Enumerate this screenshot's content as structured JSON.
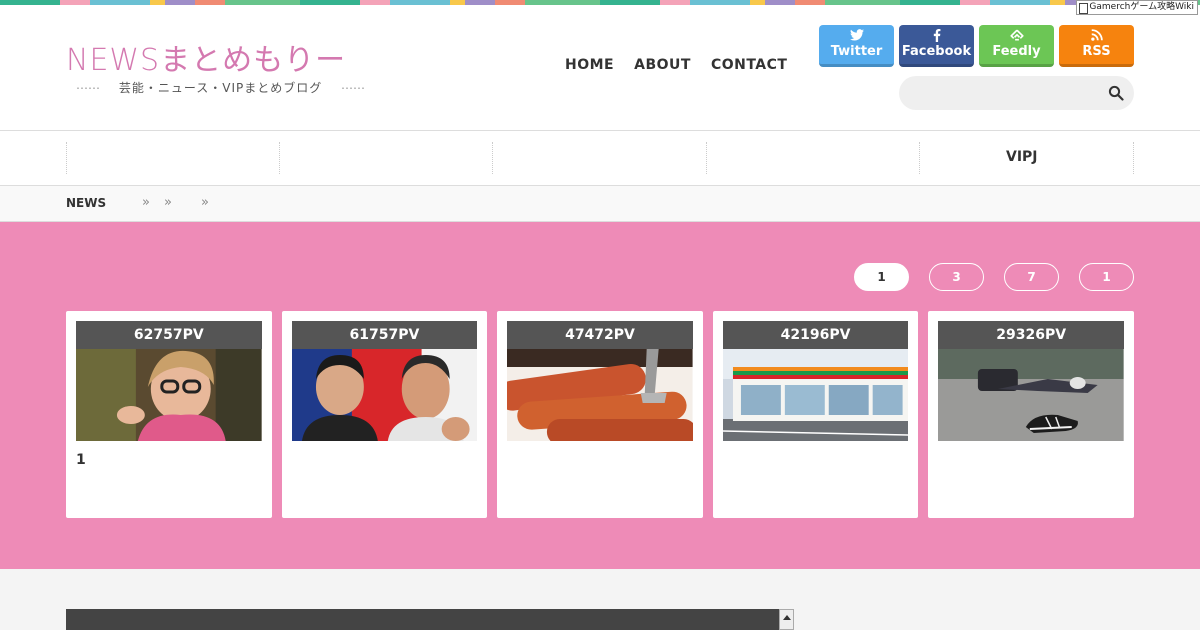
{
  "badge": {
    "text": "Gamerchゲーム攻略Wiki"
  },
  "site": {
    "logo": "NEWSまとめもりー",
    "tagline_dots_left": "⋯⋯",
    "tagline": "芸能・ニュース・VIPまとめブログ",
    "tagline_dots_right": "⋯⋯"
  },
  "nav": {
    "home": "HOME",
    "about": "ABOUT",
    "contact": "CONTACT"
  },
  "social": {
    "twitter": "Twitter",
    "facebook": "Facebook",
    "feedly": "Feedly",
    "rss": "RSS"
  },
  "search": {
    "placeholder": ""
  },
  "categories": {
    "vipj": "VIPJ"
  },
  "breadcrumb": {
    "home": "NEWS",
    "sep": "»"
  },
  "ranking": {
    "tabs": [
      "1",
      "3",
      "7",
      "1"
    ],
    "cards": [
      {
        "pv": "62757PV",
        "title": "1"
      },
      {
        "pv": "61757PV",
        "title": ""
      },
      {
        "pv": "47472PV",
        "title": ""
      },
      {
        "pv": "42196PV",
        "title": ""
      },
      {
        "pv": "29326PV",
        "title": ""
      }
    ]
  },
  "colors": {
    "ranking_bg": "#ee8bb7",
    "logo": "#d479b0",
    "twitter": "#55acee",
    "facebook": "#3b5998",
    "feedly": "#6cc655",
    "rss": "#f6830e"
  }
}
